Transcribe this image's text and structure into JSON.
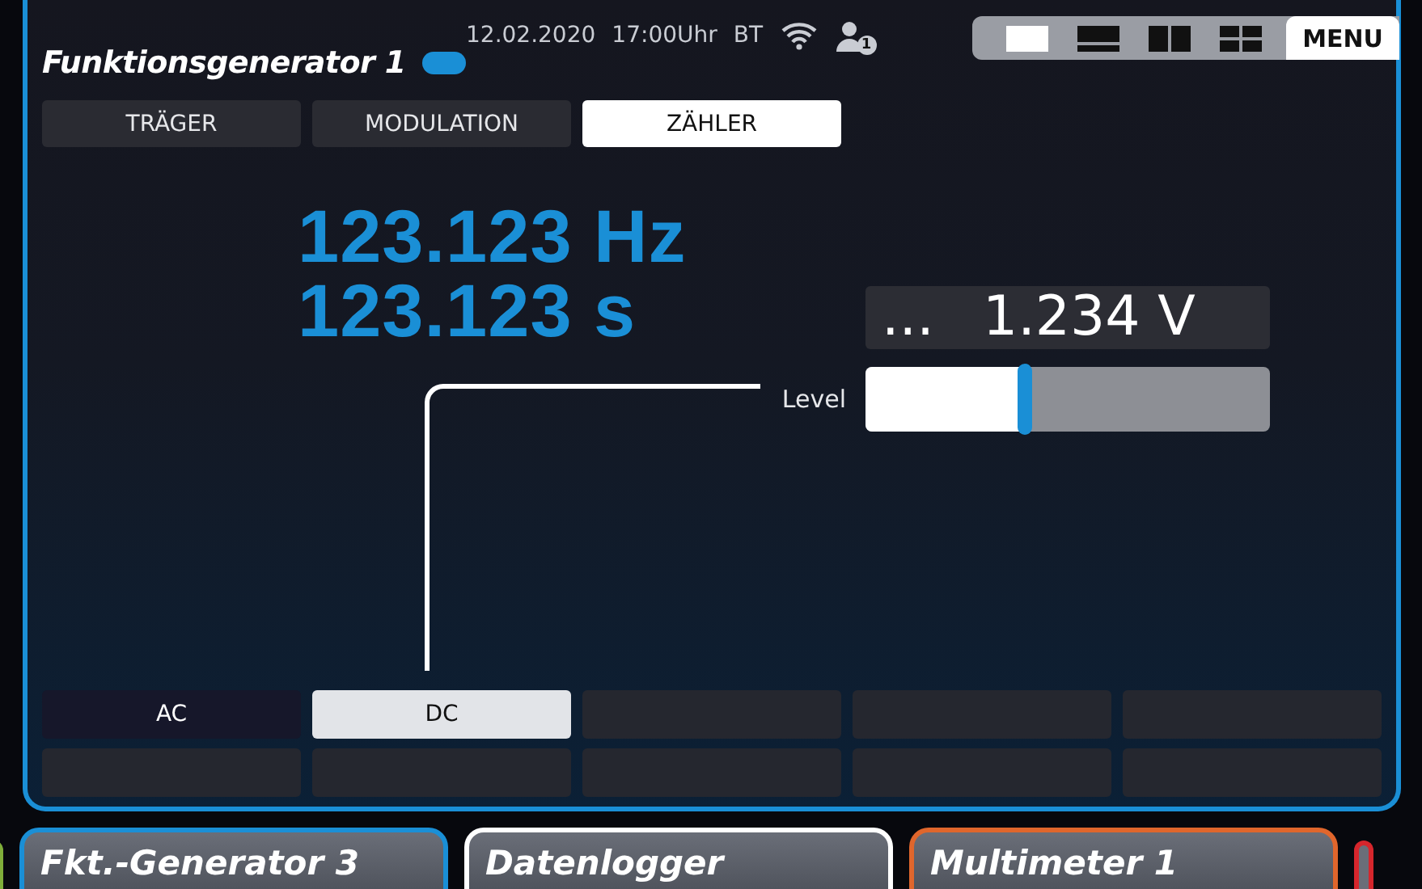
{
  "header": {
    "title": "Funktionsgenerator 1",
    "date": "12.02.2020",
    "time": "17:00Uhr",
    "bt": "BT",
    "user_badge": "1"
  },
  "layouts": [
    {
      "kind": "single",
      "selected": true
    },
    {
      "kind": "rows",
      "selected": false
    },
    {
      "kind": "columns",
      "selected": false
    },
    {
      "kind": "quad",
      "selected": false
    }
  ],
  "menu": "MENU",
  "tabs": [
    {
      "label": "TRÄGER",
      "selected": false
    },
    {
      "label": "MODULATION",
      "selected": false
    },
    {
      "label": "ZÄHLER",
      "selected": true
    }
  ],
  "readouts": [
    "123.123 Hz",
    "123.123 s"
  ],
  "value_box": {
    "prefix": "...",
    "value": "1.234 V"
  },
  "slider": {
    "label": "Level",
    "level": 0.39
  },
  "buttons": [
    {
      "label": "AC",
      "selected": false
    },
    {
      "label": "DC",
      "selected": true
    }
  ],
  "bottom_tabs": [
    {
      "color": "#7fae3a"
    },
    {
      "label": "Fkt.-Generator 3",
      "color": "#1a8fd6"
    },
    {
      "label": "Datenlogger",
      "color": "#ffffff"
    },
    {
      "label": "Multimeter 1",
      "color": "#e0662c"
    },
    {
      "color": "#d6262c"
    }
  ]
}
